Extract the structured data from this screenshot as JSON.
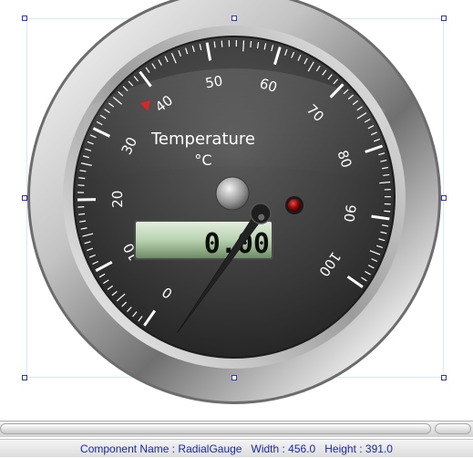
{
  "gauge": {
    "title": "Temperature",
    "unit": "°C",
    "min": 0,
    "max": 100,
    "value": 0,
    "limit_marker_value": 40,
    "tick_labels": [
      "0",
      "10",
      "20",
      "30",
      "40",
      "50",
      "60",
      "70",
      "80",
      "90",
      "100"
    ],
    "lcd_text": "0.00",
    "colors": {
      "face": "#3a3a3a",
      "bezel": "#d8d8d8",
      "lcd": "#b9d3b0",
      "needle": "#222222",
      "limit_marker": "#e02424",
      "indicator_led": "#9b0a0a"
    }
  },
  "statusbar": {
    "component_name_label": "Component Name : RadialGauge",
    "width_label": "Width : 456.0",
    "height_label": "Height : 391.0"
  }
}
